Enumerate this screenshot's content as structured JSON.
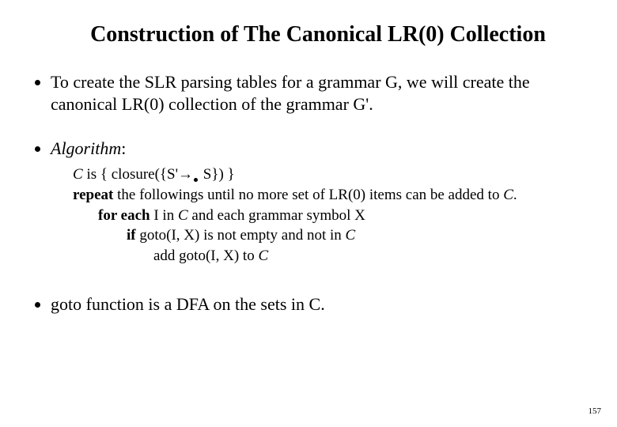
{
  "title": "Construction of The Canonical LR(0) Collection",
  "bullets": {
    "intro": "To create the SLR parsing tables for a grammar G, we will create the canonical LR(0) collection of the grammar G'.",
    "algorithm_label": "Algorithm",
    "goto_note": "goto function is a DFA on the sets in C."
  },
  "algo": {
    "l1_pre": "C",
    "l1_mid": " is { closure({S'",
    "l1_arrow": "→",
    "l1_post": " S}) }",
    "l2_a": "repeat",
    "l2_b": " the followings until no more set of LR(0) items can be added to ",
    "l2_c": "C",
    "l2_d": ".",
    "l3_a": "for each",
    "l3_b": " I in ",
    "l3_c": "C",
    "l3_d": " and each grammar symbol X",
    "l4_a": "if",
    "l4_b": " goto(I, X) is not empty and not in ",
    "l4_c": "C",
    "l5_a": "add goto(I, X) to ",
    "l5_b": "C"
  },
  "page_number": "157"
}
